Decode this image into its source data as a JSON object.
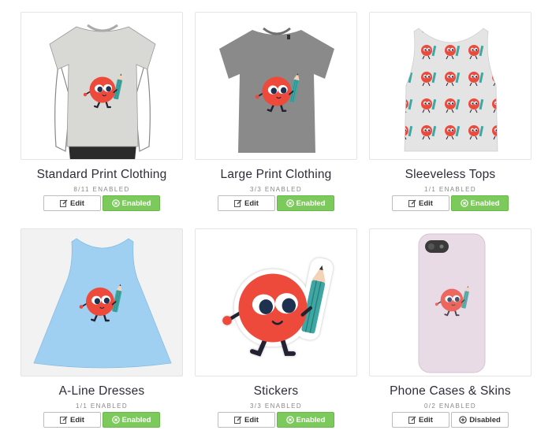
{
  "products": [
    {
      "title": "Standard Print Clothing",
      "count": "8/11 ENABLED",
      "edit_label": "Edit",
      "status_label": "Enabled",
      "status": "enabled"
    },
    {
      "title": "Large Print Clothing",
      "count": "3/3 ENABLED",
      "edit_label": "Edit",
      "status_label": "Enabled",
      "status": "enabled"
    },
    {
      "title": "Sleeveless Tops",
      "count": "1/1 ENABLED",
      "edit_label": "Edit",
      "status_label": "Enabled",
      "status": "enabled"
    },
    {
      "title": "A-Line Dresses",
      "count": "1/1 ENABLED",
      "edit_label": "Edit",
      "status_label": "Enabled",
      "status": "enabled"
    },
    {
      "title": "Stickers",
      "count": "3/3 ENABLED",
      "edit_label": "Edit",
      "status_label": "Enabled",
      "status": "enabled"
    },
    {
      "title": "Phone Cases & Skins",
      "count": "0/2 ENABLED",
      "edit_label": "Edit",
      "status_label": "Disabled",
      "status": "disabled"
    }
  ],
  "colors": {
    "enabled_green": "#7cc95c",
    "character_red": "#ee4a3c",
    "pencil_teal": "#3fa7a3",
    "dress_blue": "#9fd0f2",
    "phone_pink": "#e8dbe6"
  }
}
